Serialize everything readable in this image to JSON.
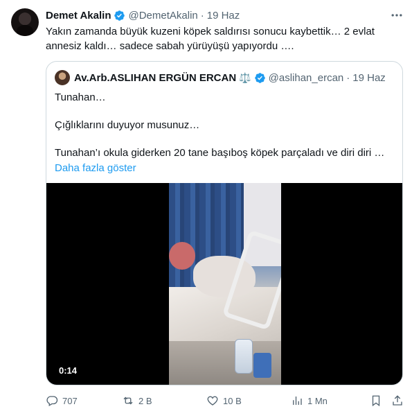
{
  "tweet": {
    "author_name": "Demet Akalin",
    "handle": "@DemetAkalin",
    "separator": "·",
    "date": "19 Haz",
    "text": "Yakın zamanda büyük kuzeni köpek saldırısı sonucu kaybettik… 2 evlat\nannesiz kaldı… sadece sabah yürüyüşü yapıyordu ….",
    "icons": {
      "verified": "verified-badge-icon",
      "more": "more-options-icon"
    }
  },
  "quote": {
    "author_name": "Av.Arb.ASLIHAN ERGÜN ERCAN",
    "scales_emoji": "⚖️",
    "handle": "@aslihan_ercan",
    "separator": "·",
    "date": "19 Haz",
    "lines": [
      "Tunahan…",
      "Çığlıklarını duyuyor musunuz…",
      "Tunahan’ı okula giderken 20 tane başıboş köpek parçaladı ve diri diri …"
    ],
    "show_more": "Daha fazla göster",
    "video": {
      "timestamp": "0:14"
    }
  },
  "actions": {
    "reply_count": "707",
    "retweet_count": "2 B",
    "like_count": "10 B",
    "views_count": "1 Mn"
  },
  "colors": {
    "accent": "#1d9bf0",
    "secondary_text": "#536471",
    "primary_text": "#0f1419",
    "border": "#cfd9de"
  }
}
